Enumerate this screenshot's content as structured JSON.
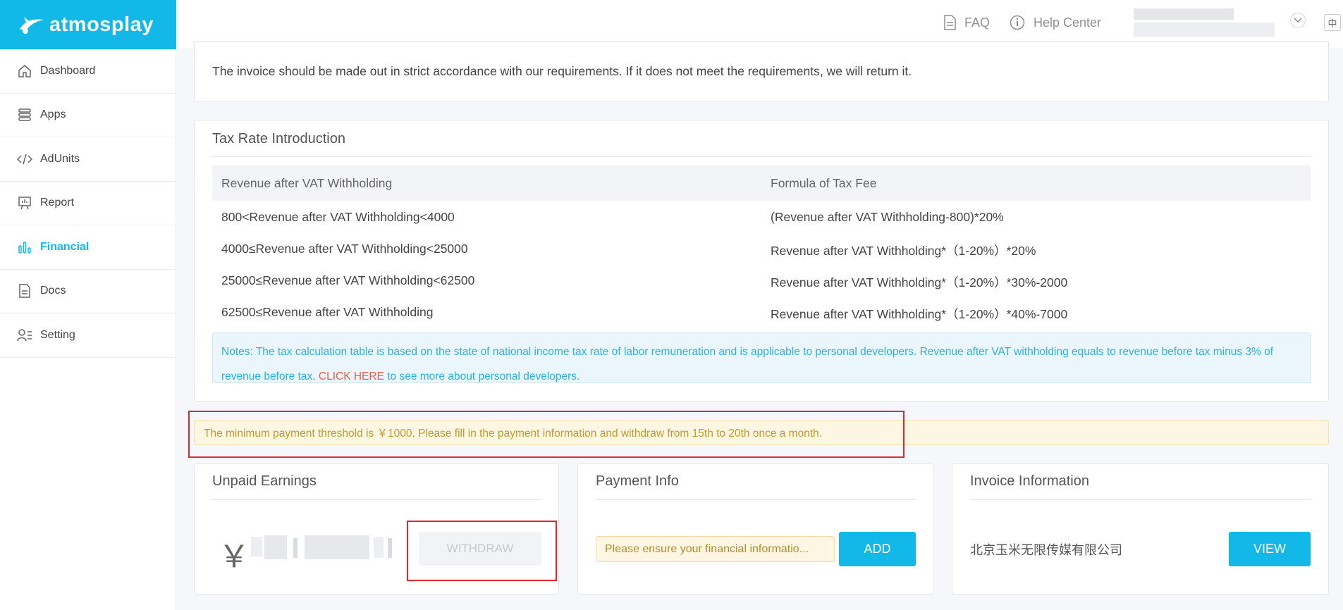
{
  "brand": {
    "name": "atmosplay",
    "color": "#12b8e8"
  },
  "header": {
    "faq": "FAQ",
    "help_center": "Help Center",
    "lang": "中"
  },
  "sidebar": {
    "items": [
      {
        "label": "Dashboard",
        "icon": "home-icon"
      },
      {
        "label": "Apps",
        "icon": "stack-icon"
      },
      {
        "label": "AdUnits",
        "icon": "code-icon"
      },
      {
        "label": "Report",
        "icon": "presentation-icon"
      },
      {
        "label": "Financial",
        "icon": "bar-chart-icon",
        "active": true
      },
      {
        "label": "Docs",
        "icon": "document-icon"
      },
      {
        "label": "Setting",
        "icon": "user-settings-icon"
      }
    ]
  },
  "invoice_note": "The invoice should be made out in strict accordance with our requirements. If it does not meet the requirements, we will return it.",
  "tax": {
    "title": "Tax Rate Introduction",
    "headers": [
      "Revenue after VAT Withholding",
      "Formula of Tax Fee"
    ],
    "rows": [
      [
        "800<Revenue after VAT Withholding<4000",
        "(Revenue after VAT Withholding-800)*20%"
      ],
      [
        "4000≤Revenue after VAT Withholding<25000",
        "Revenue after VAT Withholding*（1-20%）*20%"
      ],
      [
        "25000≤Revenue after VAT Withholding<62500",
        "Revenue after VAT Withholding*（1-20%）*30%-2000"
      ],
      [
        "62500≤Revenue after VAT Withholding",
        "Revenue after VAT Withholding*（1-20%）*40%-7000"
      ]
    ],
    "notes_text": "Notes: The tax calculation table is based on the state of national income tax rate of labor remuneration and is applicable to personal developers. Revenue after VAT withholding equals to revenue before tax minus 3% of revenue before tax.",
    "notes_link": "CLICK HERE",
    "notes_suffix": " to see more about personal developers."
  },
  "warning": "The minimum payment threshold is ￥1000. Please fill in the payment information and withdraw from 15th to 20th once a month.",
  "unpaid": {
    "title": "Unpaid Earnings",
    "currency": "￥",
    "withdraw_label": "WITHDRAW"
  },
  "payment": {
    "title": "Payment Info",
    "placeholder": "Please ensure your financial informatio...",
    "add_label": "ADD"
  },
  "invoice": {
    "title": "Invoice Information",
    "company": "北京玉米无限传媒有限公司",
    "view_label": "VIEW"
  }
}
